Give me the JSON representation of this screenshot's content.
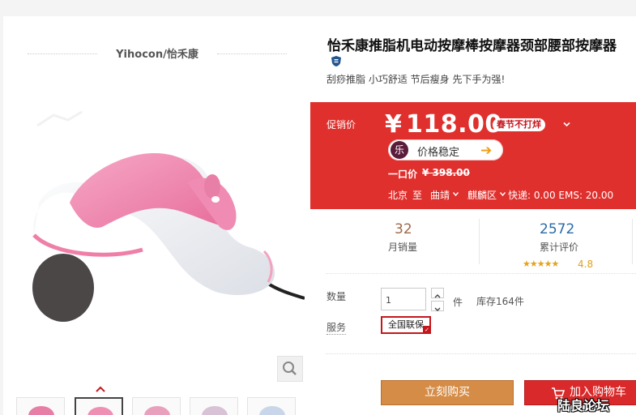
{
  "brand": {
    "label": "Yihocon/怡禾康"
  },
  "product": {
    "title": "怡禾康推脂机电动按摩棒按摩器颈部腰部按摩器",
    "subtitle": "刮痧推脂 小巧舒适 节后瘦身 先下手为强!",
    "image_icon": "massager-photo"
  },
  "price": {
    "promo_label": "促销价",
    "currency": "¥",
    "current": "118.00",
    "badge": "春节不打烊",
    "stable_logo": "乐",
    "stable_text": "价格稳定",
    "stable_arrow": "➔",
    "original_label": "一口价",
    "original_value": "¥ 398.00"
  },
  "shipping": {
    "from": "北京",
    "to_word": "至",
    "city": "曲靖",
    "district": "麒麟区",
    "fees": "快递: 0.00 EMS: 20.00"
  },
  "stats": {
    "monthly_sales": "32",
    "monthly_sales_label": "月销量",
    "reviews": "2572",
    "reviews_label": "累计评价",
    "stars": "★★★★★",
    "rating": "4.8"
  },
  "purchase": {
    "qty_label": "数量",
    "qty_value": "1",
    "unit": "件",
    "stock": "库存164件",
    "service_label": "服务",
    "service_option": "全国联保",
    "service_check": "✓",
    "buy_now": "立刻购买",
    "add_to_cart": "加入购物车"
  },
  "watermark": "陆良论坛",
  "colors": {
    "promo_red": "#e0302d",
    "buy_orange": "#d58c46",
    "cart_red": "#d9292a",
    "sales_brown": "#a0684a",
    "reviews_blue": "#2b6aa8",
    "star_gold": "#e3a31b"
  },
  "icons": [
    "shield-icon",
    "zoom-icon",
    "chevron-up-icon",
    "chevron-down-icon",
    "cart-icon",
    "check-icon",
    "arrow-right-icon"
  ]
}
